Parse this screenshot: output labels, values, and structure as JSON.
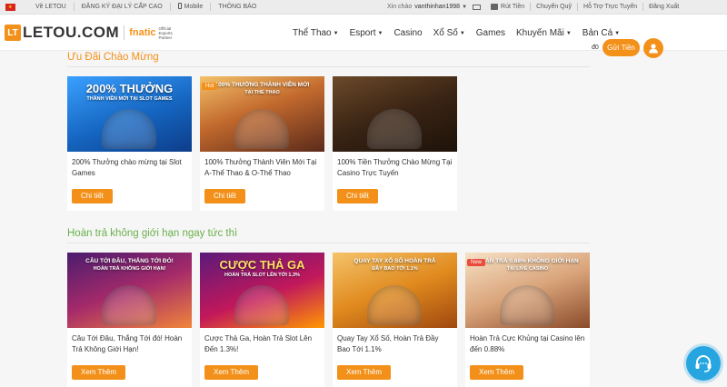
{
  "topbar": {
    "links": [
      "Về LETOU",
      "ĐĂNG KÝ ĐẠI LÝ CẤP CAO",
      "Mobile",
      "THÔNG BÁO"
    ],
    "greeting": "Xin chào",
    "username": "vanthinhan1998",
    "withdraw": "Rút Tiền",
    "transfer": "Chuyển Quỹ",
    "support": "Hỗ Trợ Trực Tuyến",
    "logout": "Đăng Xuất"
  },
  "header": {
    "logo_mark": "LT",
    "logo_text": "LETOU.COM",
    "partner_logo": "fnatic",
    "partner_text": "Official Esports Partner",
    "nav": [
      "Thể Thao",
      "Esport",
      "Casino",
      "Xổ Số",
      "Games",
      "Khuyến Mãi",
      "Bản Cá"
    ],
    "nav_has_caret": [
      true,
      true,
      false,
      true,
      false,
      true,
      true
    ],
    "balance": "đ0",
    "deposit_label": "Gửi Tiền"
  },
  "sections": [
    {
      "title": "Ưu Đãi Chào Mừng",
      "cards": [
        {
          "title": "200% Thưởng chào mừng tại Slot Games",
          "button": "Chi tiết",
          "banner": "200% THƯỞNG",
          "banner_sub": "THÀNH VIÊN MỚI TẠI SLOT GAMES",
          "tag": ""
        },
        {
          "title": "100% Thưởng Thành Viên Mới Tại A-Thể Thao & O-Thể Thao",
          "button": "Chi tiết",
          "banner": "100% THƯỞNG THÀNH VIÊN MỚI",
          "banner_sub": "TẠI THỂ THAO",
          "tag": "Hot"
        },
        {
          "title": "100% Tiền Thưởng Chào Mừng Tại Casino Trực Tuyến",
          "button": "Chi tiết",
          "banner": "",
          "banner_sub": "",
          "tag": ""
        }
      ]
    },
    {
      "title": "Hoàn trả không giới hạn ngay tức thì",
      "cards": [
        {
          "title": "Câu Tới Đâu, Thắng Tới đó! Hoàn Trả Không Giới Hạn!",
          "button": "Xem Thêm",
          "banner": "CÂU TỚI ĐÂU, THẮNG TỚI ĐÓ!",
          "banner_sub": "HOÀN TRẢ KHÔNG GIỚI HẠN!",
          "tag": ""
        },
        {
          "title": "Cược Thả Ga, Hoàn Trả Slot Lên Đến 1.3%!",
          "button": "Xem Thêm",
          "banner": "CƯỢC THẢ GA",
          "banner_sub": "HOÀN TRẢ SLOT LÊN TỚI 1.3%",
          "tag": ""
        },
        {
          "title": "Quay Tay Xổ Số, Hoàn Trả Đầy Bao Tới 1.1%",
          "button": "Xem Thêm",
          "banner": "QUAY TAY XỔ SỐ HOÀN TRẢ",
          "banner_sub": "ĐẦY BAO TỚI 1.1%",
          "tag": ""
        },
        {
          "title": "Hoàn Trả Cực Khủng tại Casino lên đến 0.88%",
          "button": "Xem Thêm",
          "banner": "HOÀN TRẢ 0.88% KHÔNG GIỚI HẠN",
          "banner_sub": "TẠI LIVE CASINO",
          "tag": "New"
        }
      ]
    }
  ],
  "colors": {
    "accent": "#f39019",
    "green_title": "#6ab04c",
    "support": "#27a5e0"
  }
}
